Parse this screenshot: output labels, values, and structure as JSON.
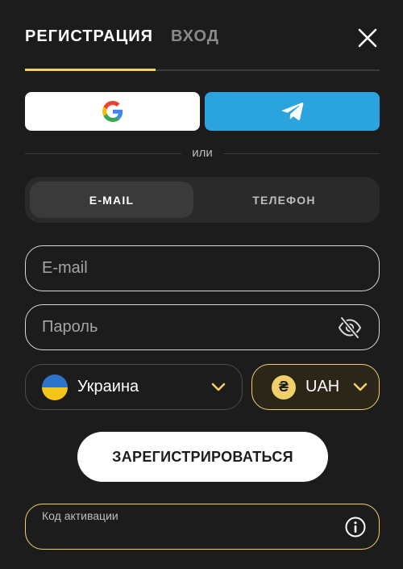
{
  "tabs": {
    "register": "РЕГИСТРАЦИЯ",
    "login": "ВХОД"
  },
  "icons": {
    "close": "close-icon",
    "google": "google-icon",
    "telegram": "telegram-icon",
    "eye_off": "eye-off-icon",
    "chevron": "chevron-down-icon",
    "flag": "ukraine-flag-icon",
    "currency": "hryvnia-icon",
    "info": "info-icon"
  },
  "divider": {
    "text": "или"
  },
  "method_toggle": {
    "email": "E-MAIL",
    "phone": "ТЕЛЕФОН",
    "selected": "email"
  },
  "form": {
    "email_placeholder": "E-mail",
    "password_placeholder": "Пароль",
    "country": "Украина",
    "currency_symbol": "₴",
    "currency": "UAH",
    "submit_label": "ЗАРЕГИСТРИРОВАТЬСЯ",
    "promo_label": "Код активации",
    "promo_value": ""
  },
  "colors": {
    "background": "#1c1c1c",
    "accent": "#f2cf6b",
    "telegram": "#2aa3de"
  }
}
